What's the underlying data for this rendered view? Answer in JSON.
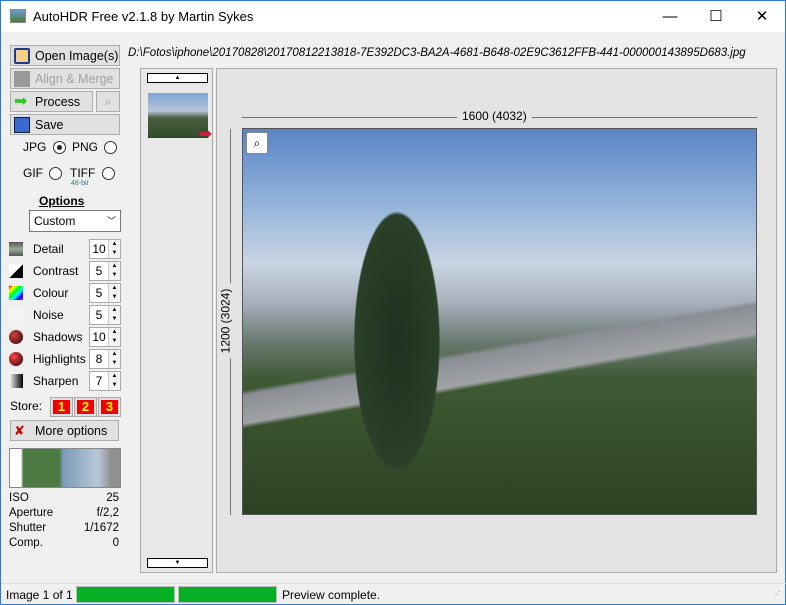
{
  "window": {
    "title": "AutoHDR Free v2.1.8 by Martin Sykes",
    "minimize": "—",
    "maximize": "☐",
    "close": "✕"
  },
  "toolbar": {
    "open": "Open Image(s)",
    "align": "Align & Merge",
    "process": "Process",
    "save": "Save"
  },
  "formats": {
    "jpg": "JPG",
    "png": "PNG",
    "gif": "GIF",
    "tiff": "TIFF",
    "tiff_note": "48-bit",
    "selected": "JPG"
  },
  "options": {
    "heading": "Options",
    "preset": "Custom",
    "settings": [
      {
        "label": "Detail",
        "value": "10"
      },
      {
        "label": "Contrast",
        "value": "5"
      },
      {
        "label": "Colour",
        "value": "5"
      },
      {
        "label": "Noise",
        "value": "5"
      },
      {
        "label": "Shadows",
        "value": "10"
      },
      {
        "label": "Highlights",
        "value": "8"
      },
      {
        "label": "Sharpen",
        "value": "7"
      }
    ],
    "store_label": "Store:",
    "store": [
      "1",
      "2",
      "3"
    ],
    "more": "More options"
  },
  "exif": [
    {
      "k": "ISO",
      "v": "25"
    },
    {
      "k": "Aperture",
      "v": "f/2,2"
    },
    {
      "k": "Shutter",
      "v": "1/1672"
    },
    {
      "k": "Comp.",
      "v": "0"
    }
  ],
  "path": "D:\\Fotos\\iphone\\20170828\\20170812213818-7E392DC3-BA2A-4681-B648-02E9C3612FFB-441-000000143895D683.jpg",
  "viewer": {
    "width_label": "1600 (4032)",
    "height_label": "1200 (3024)"
  },
  "status": {
    "image": "Image 1 of 1",
    "progress1": 1.0,
    "progress2": 1.0,
    "message": "Preview complete."
  }
}
